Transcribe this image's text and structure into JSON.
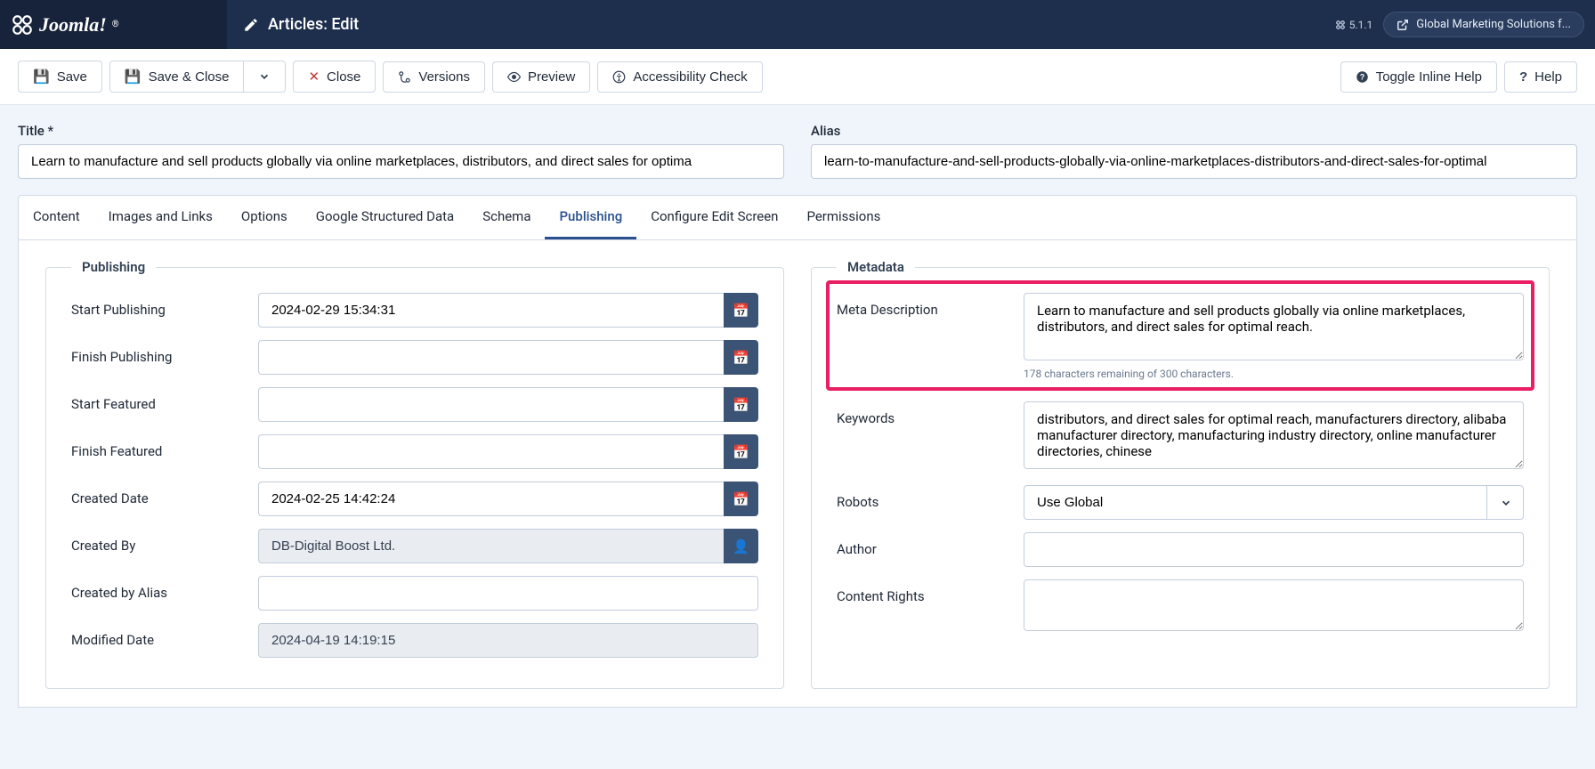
{
  "topbar": {
    "logo_text": "Joomla!",
    "page_title": "Articles: Edit",
    "version": "5.1.1",
    "site_link": "Global Marketing Solutions f..."
  },
  "toolbar": {
    "save": "Save",
    "save_close": "Save & Close",
    "close": "Close",
    "versions": "Versions",
    "preview": "Preview",
    "accessibility": "Accessibility Check",
    "toggle_help": "Toggle Inline Help",
    "help": "Help"
  },
  "fields": {
    "title_label": "Title *",
    "title_value": "Learn to manufacture and sell products globally via online marketplaces, distributors, and direct sales for optima",
    "alias_label": "Alias",
    "alias_value": "learn-to-manufacture-and-sell-products-globally-via-online-marketplaces-distributors-and-direct-sales-for-optimal"
  },
  "tabs": [
    "Content",
    "Images and Links",
    "Options",
    "Google Structured Data",
    "Schema",
    "Publishing",
    "Configure Edit Screen",
    "Permissions"
  ],
  "publishing": {
    "legend": "Publishing",
    "start_publishing_label": "Start Publishing",
    "start_publishing": "2024-02-29 15:34:31",
    "finish_publishing_label": "Finish Publishing",
    "finish_publishing": "",
    "start_featured_label": "Start Featured",
    "start_featured": "",
    "finish_featured_label": "Finish Featured",
    "finish_featured": "",
    "created_date_label": "Created Date",
    "created_date": "2024-02-25 14:42:24",
    "created_by_label": "Created By",
    "created_by": "DB-Digital Boost Ltd.",
    "created_by_alias_label": "Created by Alias",
    "created_by_alias": "",
    "modified_date_label": "Modified Date",
    "modified_date": "2024-04-19 14:19:15"
  },
  "metadata": {
    "legend": "Metadata",
    "meta_desc_label": "Meta Description",
    "meta_desc": "Learn to manufacture and sell products globally via online marketplaces, distributors, and direct sales for optimal reach.",
    "meta_desc_hint": "178 characters remaining of 300 characters.",
    "keywords_label": "Keywords",
    "keywords": "distributors, and direct sales for optimal reach, manufacturers directory, alibaba manufacturer directory, manufacturing industry directory, online manufacturer directories, chinese",
    "robots_label": "Robots",
    "robots": "Use Global",
    "author_label": "Author",
    "author": "",
    "rights_label": "Content Rights",
    "rights": ""
  }
}
